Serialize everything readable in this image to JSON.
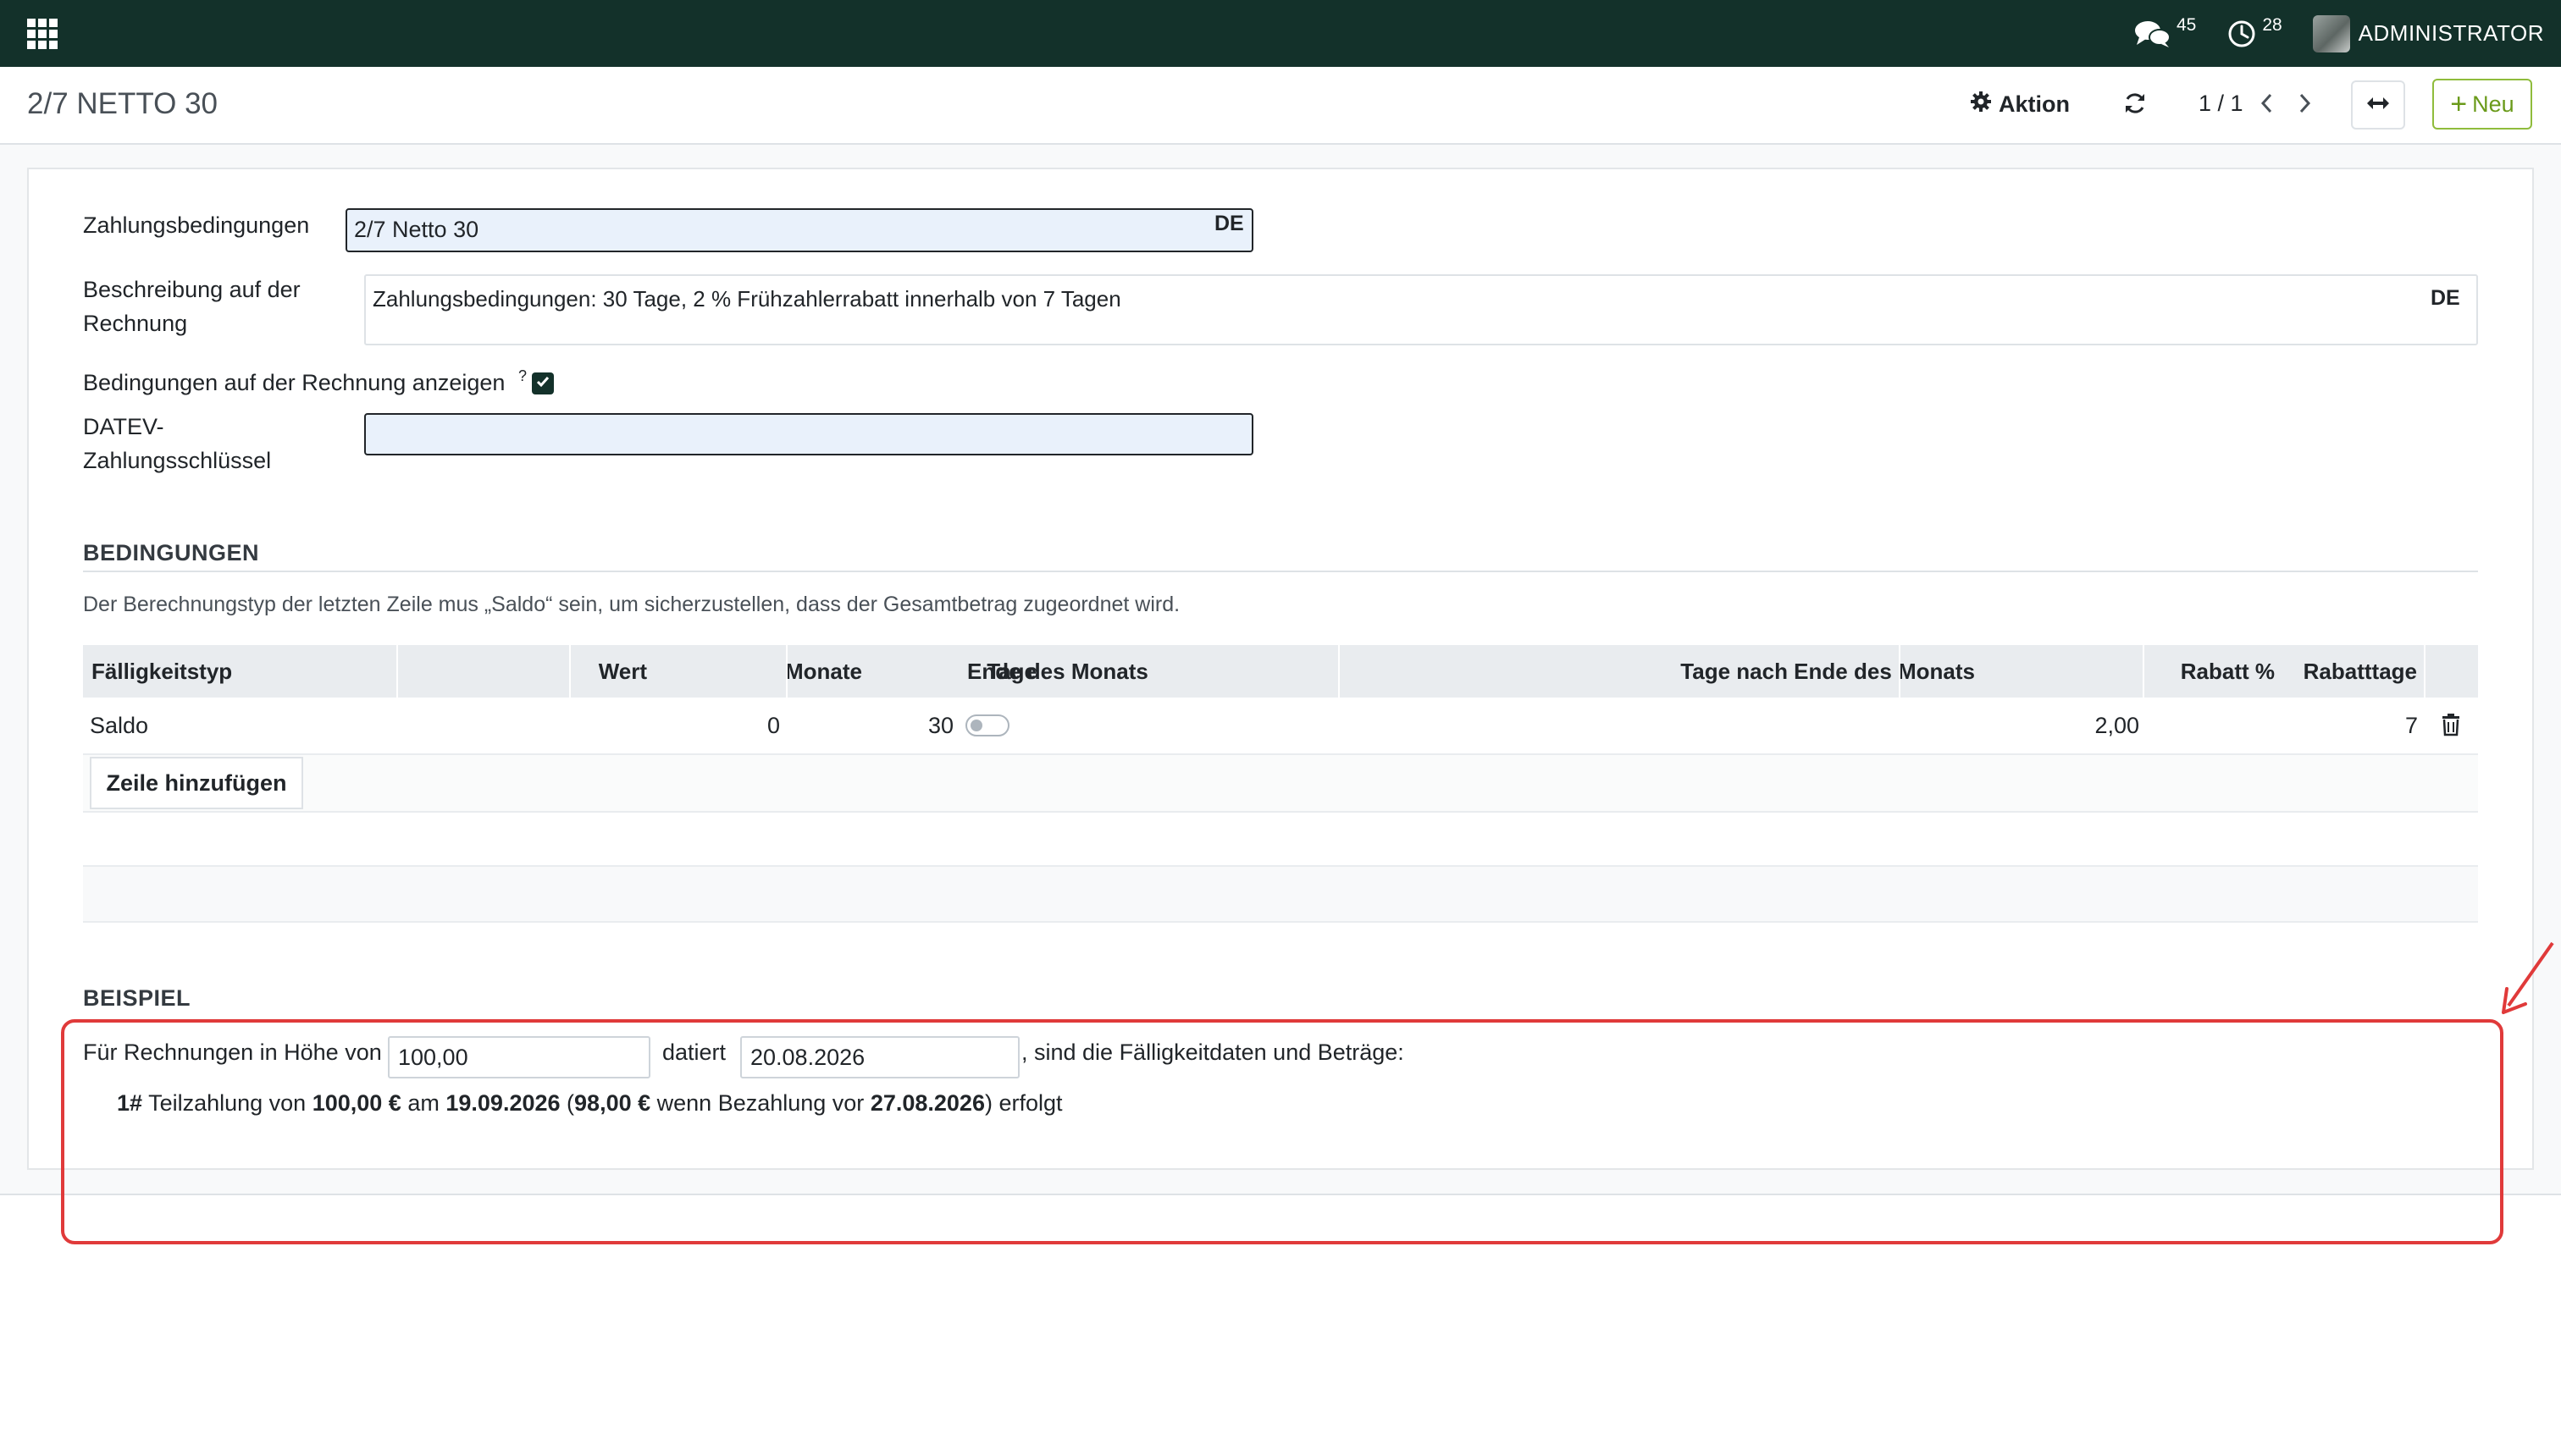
{
  "navbar": {
    "messages_count": "45",
    "activities_count": "28",
    "user_name": "ADMINISTRATOR",
    "background_color": "#13312a"
  },
  "control_panel": {
    "title": "2/7 NETTO 30",
    "action_label": "Aktion",
    "pager": "1 / 1",
    "new_label": "Neu",
    "new_color": "#6a9a1a"
  },
  "form": {
    "payment_terms_label": "Zahlungsbedingungen",
    "payment_terms_value": "2/7 Netto 30",
    "payment_terms_lang": "DE",
    "description_label_1": "Beschreibung auf der",
    "description_label_2": "Rechnung",
    "description_value": "Zahlungsbedingungen: 30 Tage, 2 % Frühzahlerrabatt innerhalb von 7 Tagen",
    "description_lang": "DE",
    "show_on_invoice_label": "Bedingungen auf der Rechnung anzeigen",
    "show_on_invoice_help": "?",
    "show_on_invoice_checked": true,
    "datev_label_1": "DATEV-",
    "datev_label_2": "Zahlungsschlüssel",
    "datev_value": ""
  },
  "terms": {
    "title": "BEDINGUNGEN",
    "hint": "Der Berechnungstyp der letzten Zeile mus „Saldo“ sein, um sicherzustellen, dass der Gesamtbetrag zugeordnet wird.",
    "columns": [
      "Fälligkeitstyp",
      "Wert",
      "Monate",
      "Tage",
      "Ende des Monats",
      "Tage nach Ende des Monats",
      "Rabatt %",
      "Rabatttage"
    ],
    "rows": [
      {
        "type": "Saldo",
        "value": "",
        "months": "0",
        "days": "30",
        "end_of_month": false,
        "days_after_eom": "",
        "discount": "2,00",
        "discount_days": "7"
      }
    ],
    "add_line_label": "Zeile hinzufügen"
  },
  "example": {
    "title": "BEISPIEL",
    "intro": "Für Rechnungen in Höhe von",
    "amount": "100,00",
    "dated_label": "datiert",
    "date": "20.08.2026",
    "suffix": ", sind die Fälligkeitdaten und Beträge:",
    "line": {
      "index": "1#",
      "text_1": "Teilzahlung von",
      "amount": "100,00 €",
      "text_2": "am",
      "due_date": "19.09.2026",
      "paren_open": "(",
      "discounted": "98,00 €",
      "text_3": "wenn Bezahlung vor",
      "discount_date": "27.08.2026",
      "text_4": ") erfolgt"
    },
    "highlight_color": "#e03a3a"
  }
}
